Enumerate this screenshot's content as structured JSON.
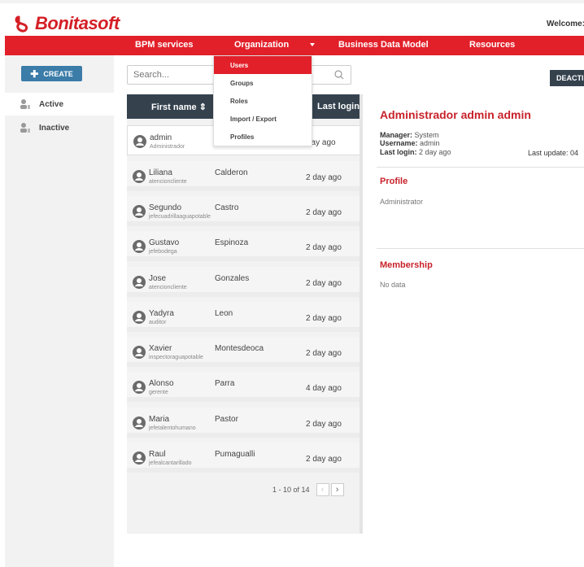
{
  "header": {
    "brand": "Bonitasoft",
    "welcome": "Welcome:"
  },
  "nav": {
    "items": [
      "BPM services",
      "Organization",
      "Business Data Model",
      "Resources"
    ]
  },
  "dropdown": {
    "items": [
      "Users",
      "Groups",
      "Roles",
      "Import / Export",
      "Profiles"
    ]
  },
  "sidebar": {
    "create_label": "CREATE",
    "items": [
      "Active",
      "Inactive"
    ]
  },
  "search": {
    "placeholder": "Search..."
  },
  "table": {
    "col_first": "First name",
    "col_last_login": "Last login",
    "rows": [
      {
        "first": "admin",
        "username": "Administrador",
        "last": "",
        "login": "day ago"
      },
      {
        "first": "Liliana",
        "username": "atencioncliente",
        "last": "Calderon",
        "login": "2 day ago"
      },
      {
        "first": "Segundo",
        "username": "jefecuadrillaaguapotable",
        "last": "Castro",
        "login": "2 day ago"
      },
      {
        "first": "Gustavo",
        "username": "jefebodega",
        "last": "Espinoza",
        "login": "2 day ago"
      },
      {
        "first": "Jose",
        "username": "atencioncliente",
        "last": "Gonzales",
        "login": "2 day ago"
      },
      {
        "first": "Yadyra",
        "username": "auditor",
        "last": "Leon",
        "login": "2 day ago"
      },
      {
        "first": "Xavier",
        "username": "inspectoraguapotable",
        "last": "Montesdeoca",
        "login": "2 day ago"
      },
      {
        "first": "Alonso",
        "username": "gerente",
        "last": "Parra",
        "login": "4 day ago"
      },
      {
        "first": "Maria",
        "username": "jefetalentohumano",
        "last": "Pastor",
        "login": "2 day ago"
      },
      {
        "first": "Raul",
        "username": "jefealcantarillado",
        "last": "Pumagualli",
        "login": "2 day ago"
      }
    ],
    "pager": "1 - 10 of 14"
  },
  "details": {
    "deactivate_label": "DEACTI",
    "title": "Administrador admin admin",
    "manager_label": "Manager:",
    "manager_value": "System",
    "username_label": "Username:",
    "username_value": "admin",
    "lastlogin_label": "Last login:",
    "lastlogin_value": "2 day ago",
    "last_update": "Last update: 04",
    "profile_title": "Profile",
    "profile_value": "Administrator",
    "membership_title": "Membership",
    "membership_value": "No data"
  },
  "colors": {
    "brand_red": "#e2202a",
    "dark_header": "#35424e",
    "create_blue": "#3b7ca8"
  }
}
